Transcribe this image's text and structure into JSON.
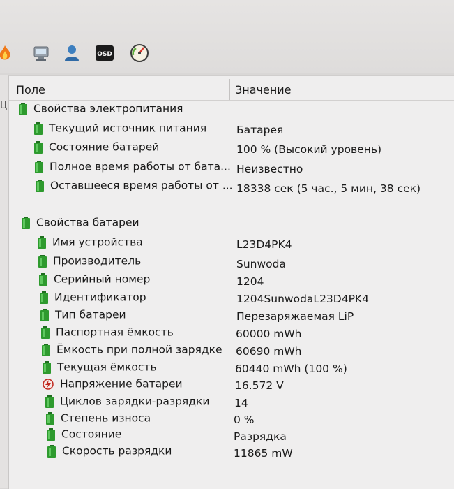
{
  "header": {
    "field": "Поле",
    "value": "Значение"
  },
  "left_clip": "Ц",
  "groups": [
    {
      "title": "Свойства электропитания",
      "items": [
        {
          "label": "Текущий источник питания",
          "value": "Батарея"
        },
        {
          "label": "Состояние батарей",
          "value": "100 % (Высокий уровень)"
        },
        {
          "label": "Полное время работы от бата...",
          "value": "Неизвестно"
        },
        {
          "label": "Оставшееся время работы от ...",
          "value": "18338 сек (5 час., 5 мин, 38 сек)"
        }
      ]
    },
    {
      "title": "Свойства батареи",
      "items": [
        {
          "label": "Имя устройства",
          "value": "L23D4PK4"
        },
        {
          "label": "Производитель",
          "value": "Sunwoda"
        },
        {
          "label": "Серийный номер",
          "value": "1204"
        },
        {
          "label": "Идентификатор",
          "value": "1204SunwodaL23D4PK4"
        },
        {
          "label": "Тип батареи",
          "value": "Перезаряжаемая LiP"
        },
        {
          "label": "Паспортная ёмкость",
          "value": "60000 mWh"
        },
        {
          "label": "Ёмкость при полной зарядке",
          "value": "60690 mWh"
        },
        {
          "label": "Текущая ёмкость",
          "value": "60440 mWh  (100 %)"
        },
        {
          "label": "Напряжение батареи",
          "value": "16.572 V"
        },
        {
          "label": "Циклов зарядки-разрядки",
          "value": "14"
        },
        {
          "label": "Степень износа",
          "value": "0 %"
        },
        {
          "label": "Состояние",
          "value": "Разрядка"
        },
        {
          "label": "Скорость разрядки",
          "value": "11865 mW"
        }
      ]
    }
  ],
  "icons": {
    "toolbar": [
      "flame-icon",
      "computer-icon",
      "user-icon",
      "osd-icon",
      "gauge-icon"
    ],
    "battery_color": "#2e9a2e",
    "voltage_icon": "lightning-icon"
  },
  "colors": {
    "panel_bg": "#efeeee",
    "toolbar_bg": "#e3e1e0"
  }
}
